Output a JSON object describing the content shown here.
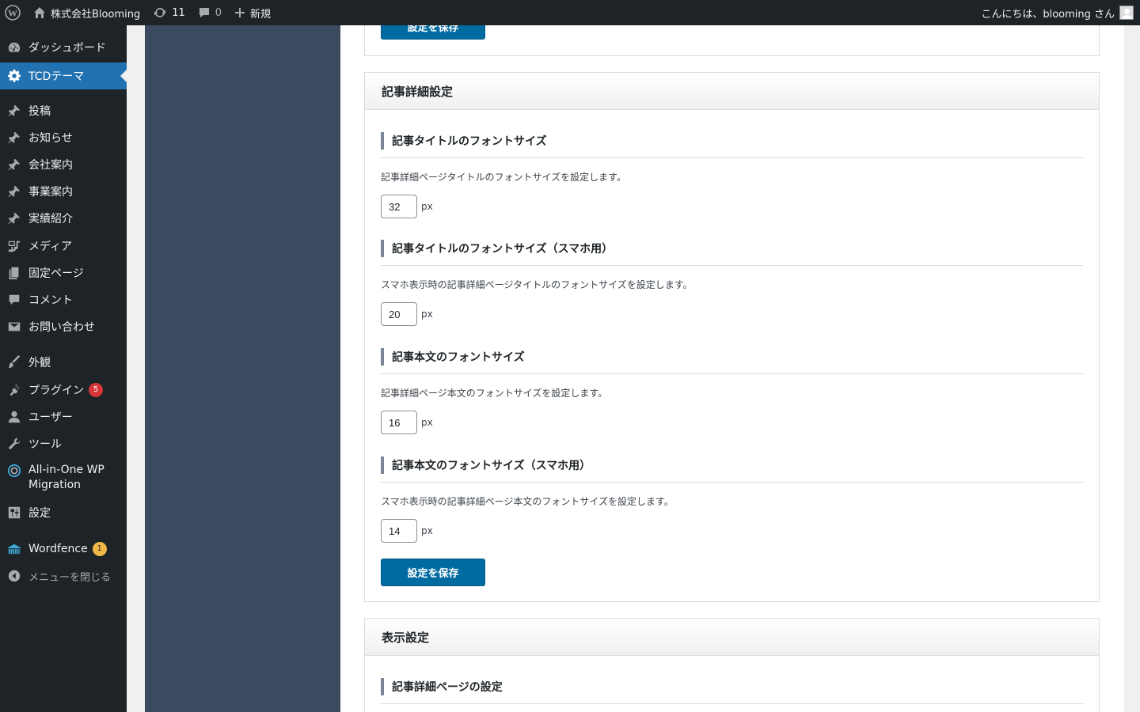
{
  "adminbar": {
    "site_name": "株式会社Blooming",
    "updates_count": "11",
    "comments_count": "0",
    "new_label": "新規",
    "greeting": "こんにちは、blooming さん"
  },
  "sidebar": {
    "items": [
      {
        "label": "ダッシュボード",
        "icon": "dashboard-icon"
      },
      {
        "label": "TCDテーマ",
        "icon": "gear-icon",
        "current": true
      },
      {
        "label": "投稿",
        "icon": "pin-icon"
      },
      {
        "label": "お知らせ",
        "icon": "pin-icon"
      },
      {
        "label": "会社案内",
        "icon": "pin-icon"
      },
      {
        "label": "事業案内",
        "icon": "pin-icon"
      },
      {
        "label": "実績紹介",
        "icon": "pin-icon"
      },
      {
        "label": "メディア",
        "icon": "media-icon"
      },
      {
        "label": "固定ページ",
        "icon": "pages-icon"
      },
      {
        "label": "コメント",
        "icon": "comment-icon"
      },
      {
        "label": "お問い合わせ",
        "icon": "mail-icon"
      },
      {
        "label": "外観",
        "icon": "brush-icon"
      },
      {
        "label": "プラグイン",
        "icon": "plugin-icon",
        "badge": "5"
      },
      {
        "label": "ユーザー",
        "icon": "user-icon"
      },
      {
        "label": "ツール",
        "icon": "wrench-icon"
      },
      {
        "label": "All-in-One WP",
        "label2": "Migration",
        "icon": "migration-icon"
      },
      {
        "label": "設定",
        "icon": "settings-icon"
      },
      {
        "label": "Wordfence",
        "icon": "wordfence-icon",
        "badge": "1"
      },
      {
        "label": "メニューを閉じる",
        "icon": "collapse-icon"
      }
    ]
  },
  "top_box": {
    "save_label": "設定を保存"
  },
  "detail_box": {
    "title": "記事詳細設定",
    "sections": [
      {
        "title": "記事タイトルのフォントサイズ",
        "desc": "記事詳細ページタイトルのフォントサイズを設定します。",
        "value": "32",
        "unit": "px"
      },
      {
        "title": "記事タイトルのフォントサイズ（スマホ用）",
        "desc": "スマホ表示時の記事詳細ページタイトルのフォントサイズを設定します。",
        "value": "20",
        "unit": "px"
      },
      {
        "title": "記事本文のフォントサイズ",
        "desc": "記事詳細ページ本文のフォントサイズを設定します。",
        "value": "16",
        "unit": "px"
      },
      {
        "title": "記事本文のフォントサイズ（スマホ用）",
        "desc": "スマホ表示時の記事詳細ページ本文のフォントサイズを設定します。",
        "value": "14",
        "unit": "px"
      }
    ],
    "save_label": "設定を保存"
  },
  "display_box": {
    "title": "表示設定",
    "sections": [
      {
        "title": "記事詳細ページの設定"
      }
    ]
  },
  "colors": {
    "adminbar_bg": "#1d2327",
    "menu_current": "#2271b1",
    "theme_nav_bg": "#3c4a60",
    "primary_button": "#006ba1"
  }
}
